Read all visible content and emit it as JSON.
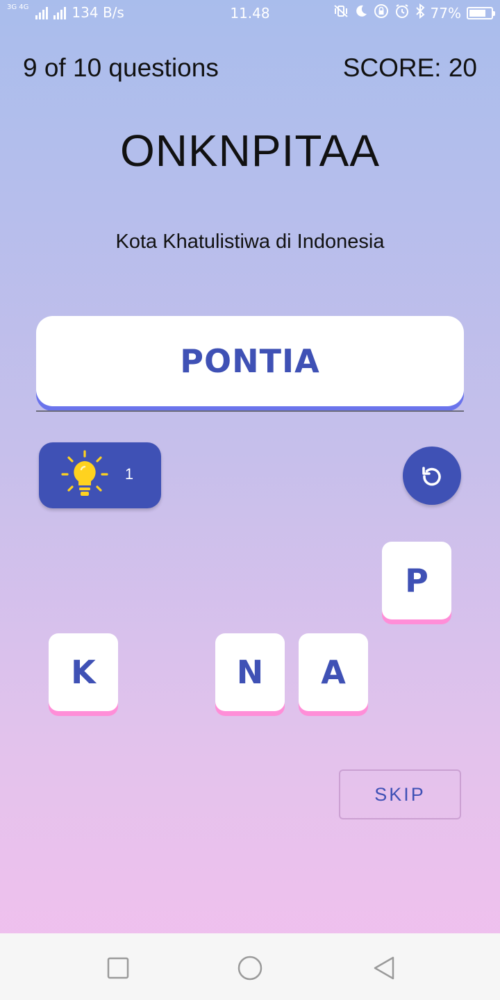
{
  "status_bar": {
    "network_tag": "3G 4G",
    "speed": "134 B/s",
    "time": "11.48",
    "battery": "77%",
    "battery_level": 0.77,
    "icons": [
      "signal-icon",
      "vibrate-icon",
      "moon-icon",
      "lock-rotation-icon",
      "alarm-icon",
      "bluetooth-icon",
      "battery-icon"
    ]
  },
  "header": {
    "progress": "9 of 10 questions",
    "score": "SCORE: 20"
  },
  "puzzle": {
    "scrambled_word": "ONKNPITAA",
    "hint": "Kota Khatulistiwa di Indonesia"
  },
  "answer": {
    "current": "PONTIA"
  },
  "controls": {
    "hint_icon": "lightbulb-icon",
    "hint_count": "1",
    "reset_icon": "reset-icon",
    "skip_label": "SKIP"
  },
  "tiles": [
    {
      "letter": "P"
    },
    {
      "letter": "K"
    },
    {
      "letter": "N"
    },
    {
      "letter": "A"
    }
  ],
  "colors": {
    "primary": "#3f51b5",
    "tile_shadow": "#ff8ed8",
    "answer_shadow": "#6b74ec",
    "bulb": "#ffd21f"
  },
  "nav": {
    "icons": [
      "recent-apps-icon",
      "home-icon",
      "back-icon"
    ]
  }
}
